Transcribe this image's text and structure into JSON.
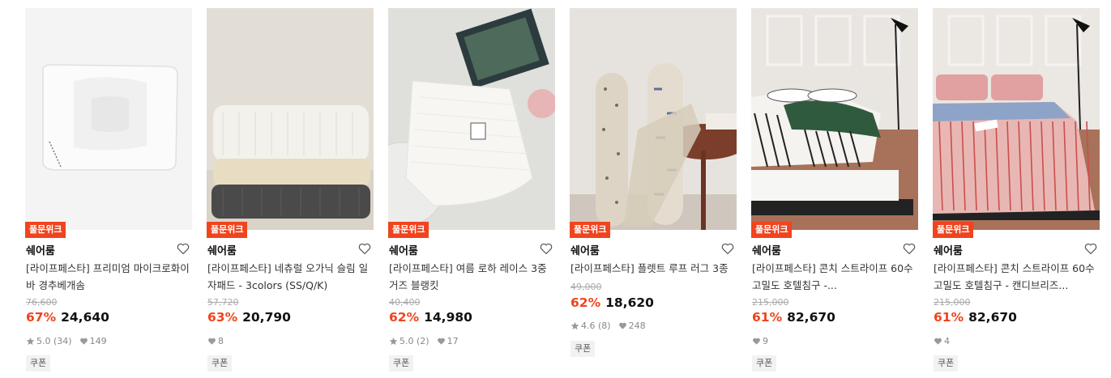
{
  "badge_label": "풀문위크",
  "coupon_label": "쿠폰",
  "products": [
    {
      "brand": "쉐어룸",
      "title": "[라이프페스타] 프리미엄 마이크로화이바 경추베개솜",
      "original_price": "76,600",
      "discount": "67%",
      "price": "24,640",
      "rating": "5.0 (34)",
      "likes": "149",
      "has_rating": true
    },
    {
      "brand": "쉐어룸",
      "title": "[라이프페스타] 네츄럴 오가닉 슬림 일자패드 - 3colors (SS/Q/K)",
      "original_price": "57,720",
      "discount": "63%",
      "price": "20,790",
      "rating": "",
      "likes": "8",
      "has_rating": false
    },
    {
      "brand": "쉐어룸",
      "title": "[라이프페스타] 여름 로하 레이스 3중 거즈 블랭킷",
      "original_price": "40,400",
      "discount": "62%",
      "price": "14,980",
      "rating": "5.0 (2)",
      "likes": "17",
      "has_rating": true
    },
    {
      "brand": "쉐어룸",
      "title": "[라이프페스타] 플렛트 루프 러그 3종",
      "original_price": "49,000",
      "discount": "62%",
      "price": "18,620",
      "rating": "4.6 (8)",
      "likes": "248",
      "has_rating": true
    },
    {
      "brand": "쉐어룸",
      "title": "[라이프페스타] 콘치 스트라이프 60수 고밀도 호텔침구 -...",
      "original_price": "215,000",
      "discount": "61%",
      "price": "82,670",
      "rating": "",
      "likes": "9",
      "has_rating": false
    },
    {
      "brand": "쉐어룸",
      "title": "[라이프페스타] 콘치 스트라이프 60수 고밀도 호텔침구 - 캔디브리즈...",
      "original_price": "215,000",
      "discount": "61%",
      "price": "82,670",
      "rating": "",
      "likes": "4",
      "has_rating": false
    }
  ],
  "colors": {
    "accent": "#f0441e",
    "text": "#111111",
    "muted": "#888888"
  },
  "icons": [
    "heart-outline-icon",
    "star-icon",
    "heart-filled-icon"
  ]
}
